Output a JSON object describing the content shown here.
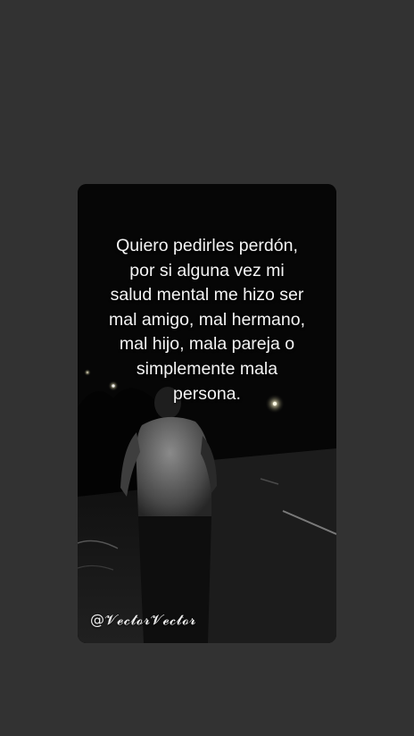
{
  "story": {
    "quote": "Quiero pedirles perdón,\npor si alguna vez mi\nsalud mental me hizo ser\nmal amigo, mal hermano,\nmal hijo, mala pareja o\nsimplemente mala\npersona.",
    "watermark": "@𝓥𝓮𝓬𝓽𝓸𝓻𝓥𝓮𝓬𝓽𝓸𝓻"
  },
  "colors": {
    "page_background": "#323232",
    "card_background": "#080808",
    "text": "#f4f4f4"
  }
}
